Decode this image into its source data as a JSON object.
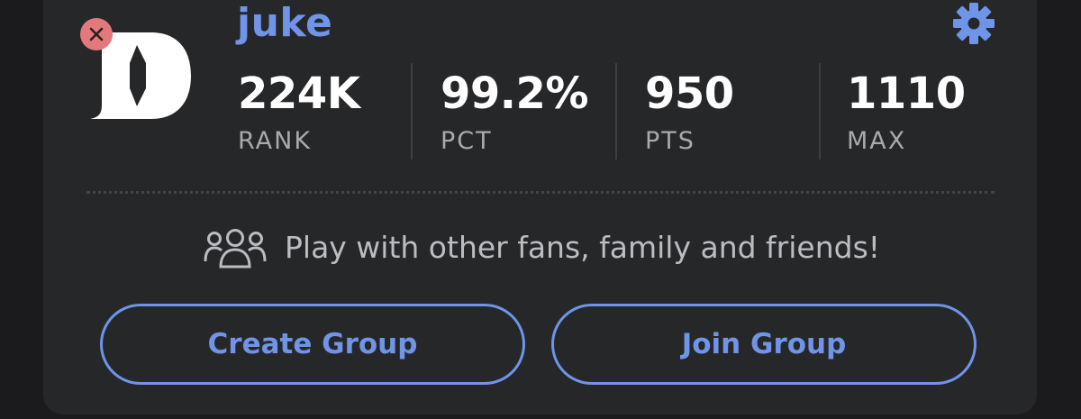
{
  "profile": {
    "username": "juke",
    "logo_icon": "team-logo-d",
    "remove_icon": "close-icon",
    "settings_icon": "gear-icon"
  },
  "stats": [
    {
      "value": "224K",
      "label": "RANK"
    },
    {
      "value": "99.2%",
      "label": "PCT"
    },
    {
      "value": "950",
      "label": "PTS"
    },
    {
      "value": "1110",
      "label": "MAX"
    }
  ],
  "groups": {
    "icon": "group-icon",
    "prompt": "Play with other fans, family and friends!",
    "create_label": "Create Group",
    "join_label": "Join Group"
  },
  "colors": {
    "background": "#1b1b1d",
    "card": "#262729",
    "accent": "#6f94e8",
    "remove_badge": "#e3797a",
    "text_primary": "#ffffff",
    "text_secondary": "#a9aaae"
  }
}
